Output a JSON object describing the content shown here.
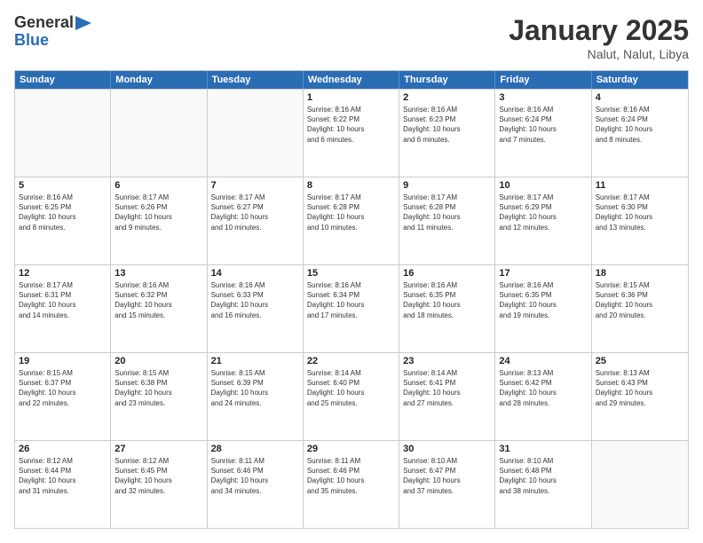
{
  "logo": {
    "general": "General",
    "blue": "Blue"
  },
  "header": {
    "month": "January 2025",
    "location": "Nalut, Nalut, Libya"
  },
  "days": [
    "Sunday",
    "Monday",
    "Tuesday",
    "Wednesday",
    "Thursday",
    "Friday",
    "Saturday"
  ],
  "weeks": [
    [
      {
        "day": "",
        "info": ""
      },
      {
        "day": "",
        "info": ""
      },
      {
        "day": "",
        "info": ""
      },
      {
        "day": "1",
        "info": "Sunrise: 8:16 AM\nSunset: 6:22 PM\nDaylight: 10 hours\nand 6 minutes."
      },
      {
        "day": "2",
        "info": "Sunrise: 8:16 AM\nSunset: 6:23 PM\nDaylight: 10 hours\nand 6 minutes."
      },
      {
        "day": "3",
        "info": "Sunrise: 8:16 AM\nSunset: 6:24 PM\nDaylight: 10 hours\nand 7 minutes."
      },
      {
        "day": "4",
        "info": "Sunrise: 8:16 AM\nSunset: 6:24 PM\nDaylight: 10 hours\nand 8 minutes."
      }
    ],
    [
      {
        "day": "5",
        "info": "Sunrise: 8:16 AM\nSunset: 6:25 PM\nDaylight: 10 hours\nand 8 minutes."
      },
      {
        "day": "6",
        "info": "Sunrise: 8:17 AM\nSunset: 6:26 PM\nDaylight: 10 hours\nand 9 minutes."
      },
      {
        "day": "7",
        "info": "Sunrise: 8:17 AM\nSunset: 6:27 PM\nDaylight: 10 hours\nand 10 minutes."
      },
      {
        "day": "8",
        "info": "Sunrise: 8:17 AM\nSunset: 6:28 PM\nDaylight: 10 hours\nand 10 minutes."
      },
      {
        "day": "9",
        "info": "Sunrise: 8:17 AM\nSunset: 6:28 PM\nDaylight: 10 hours\nand 11 minutes."
      },
      {
        "day": "10",
        "info": "Sunrise: 8:17 AM\nSunset: 6:29 PM\nDaylight: 10 hours\nand 12 minutes."
      },
      {
        "day": "11",
        "info": "Sunrise: 8:17 AM\nSunset: 6:30 PM\nDaylight: 10 hours\nand 13 minutes."
      }
    ],
    [
      {
        "day": "12",
        "info": "Sunrise: 8:17 AM\nSunset: 6:31 PM\nDaylight: 10 hours\nand 14 minutes."
      },
      {
        "day": "13",
        "info": "Sunrise: 8:16 AM\nSunset: 6:32 PM\nDaylight: 10 hours\nand 15 minutes."
      },
      {
        "day": "14",
        "info": "Sunrise: 8:16 AM\nSunset: 6:33 PM\nDaylight: 10 hours\nand 16 minutes."
      },
      {
        "day": "15",
        "info": "Sunrise: 8:16 AM\nSunset: 6:34 PM\nDaylight: 10 hours\nand 17 minutes."
      },
      {
        "day": "16",
        "info": "Sunrise: 8:16 AM\nSunset: 6:35 PM\nDaylight: 10 hours\nand 18 minutes."
      },
      {
        "day": "17",
        "info": "Sunrise: 8:16 AM\nSunset: 6:35 PM\nDaylight: 10 hours\nand 19 minutes."
      },
      {
        "day": "18",
        "info": "Sunrise: 8:15 AM\nSunset: 6:36 PM\nDaylight: 10 hours\nand 20 minutes."
      }
    ],
    [
      {
        "day": "19",
        "info": "Sunrise: 8:15 AM\nSunset: 6:37 PM\nDaylight: 10 hours\nand 22 minutes."
      },
      {
        "day": "20",
        "info": "Sunrise: 8:15 AM\nSunset: 6:38 PM\nDaylight: 10 hours\nand 23 minutes."
      },
      {
        "day": "21",
        "info": "Sunrise: 8:15 AM\nSunset: 6:39 PM\nDaylight: 10 hours\nand 24 minutes."
      },
      {
        "day": "22",
        "info": "Sunrise: 8:14 AM\nSunset: 6:40 PM\nDaylight: 10 hours\nand 25 minutes."
      },
      {
        "day": "23",
        "info": "Sunrise: 8:14 AM\nSunset: 6:41 PM\nDaylight: 10 hours\nand 27 minutes."
      },
      {
        "day": "24",
        "info": "Sunrise: 8:13 AM\nSunset: 6:42 PM\nDaylight: 10 hours\nand 28 minutes."
      },
      {
        "day": "25",
        "info": "Sunrise: 8:13 AM\nSunset: 6:43 PM\nDaylight: 10 hours\nand 29 minutes."
      }
    ],
    [
      {
        "day": "26",
        "info": "Sunrise: 8:12 AM\nSunset: 6:44 PM\nDaylight: 10 hours\nand 31 minutes."
      },
      {
        "day": "27",
        "info": "Sunrise: 8:12 AM\nSunset: 6:45 PM\nDaylight: 10 hours\nand 32 minutes."
      },
      {
        "day": "28",
        "info": "Sunrise: 8:11 AM\nSunset: 6:46 PM\nDaylight: 10 hours\nand 34 minutes."
      },
      {
        "day": "29",
        "info": "Sunrise: 8:11 AM\nSunset: 6:46 PM\nDaylight: 10 hours\nand 35 minutes."
      },
      {
        "day": "30",
        "info": "Sunrise: 8:10 AM\nSunset: 6:47 PM\nDaylight: 10 hours\nand 37 minutes."
      },
      {
        "day": "31",
        "info": "Sunrise: 8:10 AM\nSunset: 6:48 PM\nDaylight: 10 hours\nand 38 minutes."
      },
      {
        "day": "",
        "info": ""
      }
    ]
  ]
}
